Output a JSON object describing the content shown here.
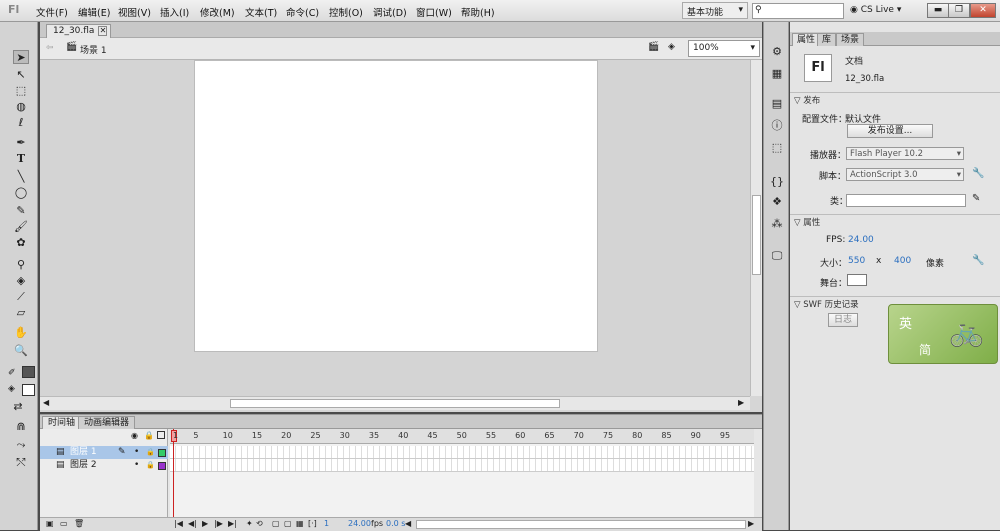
{
  "menubar": {
    "logo": "Fl",
    "items": [
      "文件(F)",
      "编辑(E)",
      "视图(V)",
      "插入(I)",
      "修改(M)",
      "文本(T)",
      "命令(C)",
      "控制(O)",
      "调试(D)",
      "窗口(W)",
      "帮助(H)"
    ],
    "workspace": "基本功能",
    "cs_live": "CS Live"
  },
  "document": {
    "tab": "12_30.fla",
    "scene": "场景 1",
    "zoom": "100%"
  },
  "timeline": {
    "tabs": [
      "时间轴",
      "动画编辑器"
    ],
    "frame_numbers": [
      "1",
      "5",
      "10",
      "15",
      "20",
      "25",
      "30",
      "35",
      "40",
      "45",
      "50",
      "55",
      "60",
      "65",
      "70",
      "75",
      "80",
      "85",
      "90",
      "95"
    ],
    "layers": [
      "图层 1",
      "图层 2"
    ],
    "current_frame": "1",
    "fps": "24.00",
    "fps_unit": "fps",
    "time": "0.0 s"
  },
  "properties": {
    "tabs": [
      "属性",
      "库",
      "场景"
    ],
    "doc_type": "文档",
    "doc_icon": "Fl",
    "file_name": "12_30.fla",
    "publish_section": "发布",
    "profile_label": "配置文件：",
    "profile_value": "默认文件",
    "publish_settings_button": "发布设置...",
    "player_label": "播放器：",
    "player_value": "Flash Player 10.2",
    "script_label": "脚本：",
    "script_value": "ActionScript 3.0",
    "class_label": "类：",
    "props_section": "属性",
    "fps_label": "FPS:",
    "fps_value": "24.00",
    "size_label": "大小：",
    "width": "550",
    "x_sep": "x",
    "height": "400",
    "size_unit": "像素",
    "stage_label": "舞台：",
    "swf_section": "SWF 历史记录",
    "log_button": "日志"
  },
  "sticker": {
    "top_char": "英",
    "bottom_char": "简"
  },
  "colors": {
    "stage": "#ffffff",
    "layer1_color": "#33cc66",
    "layer2_color": "#9933cc",
    "playhead": "#cc2222",
    "selected_layer": "#a9c6e8"
  }
}
